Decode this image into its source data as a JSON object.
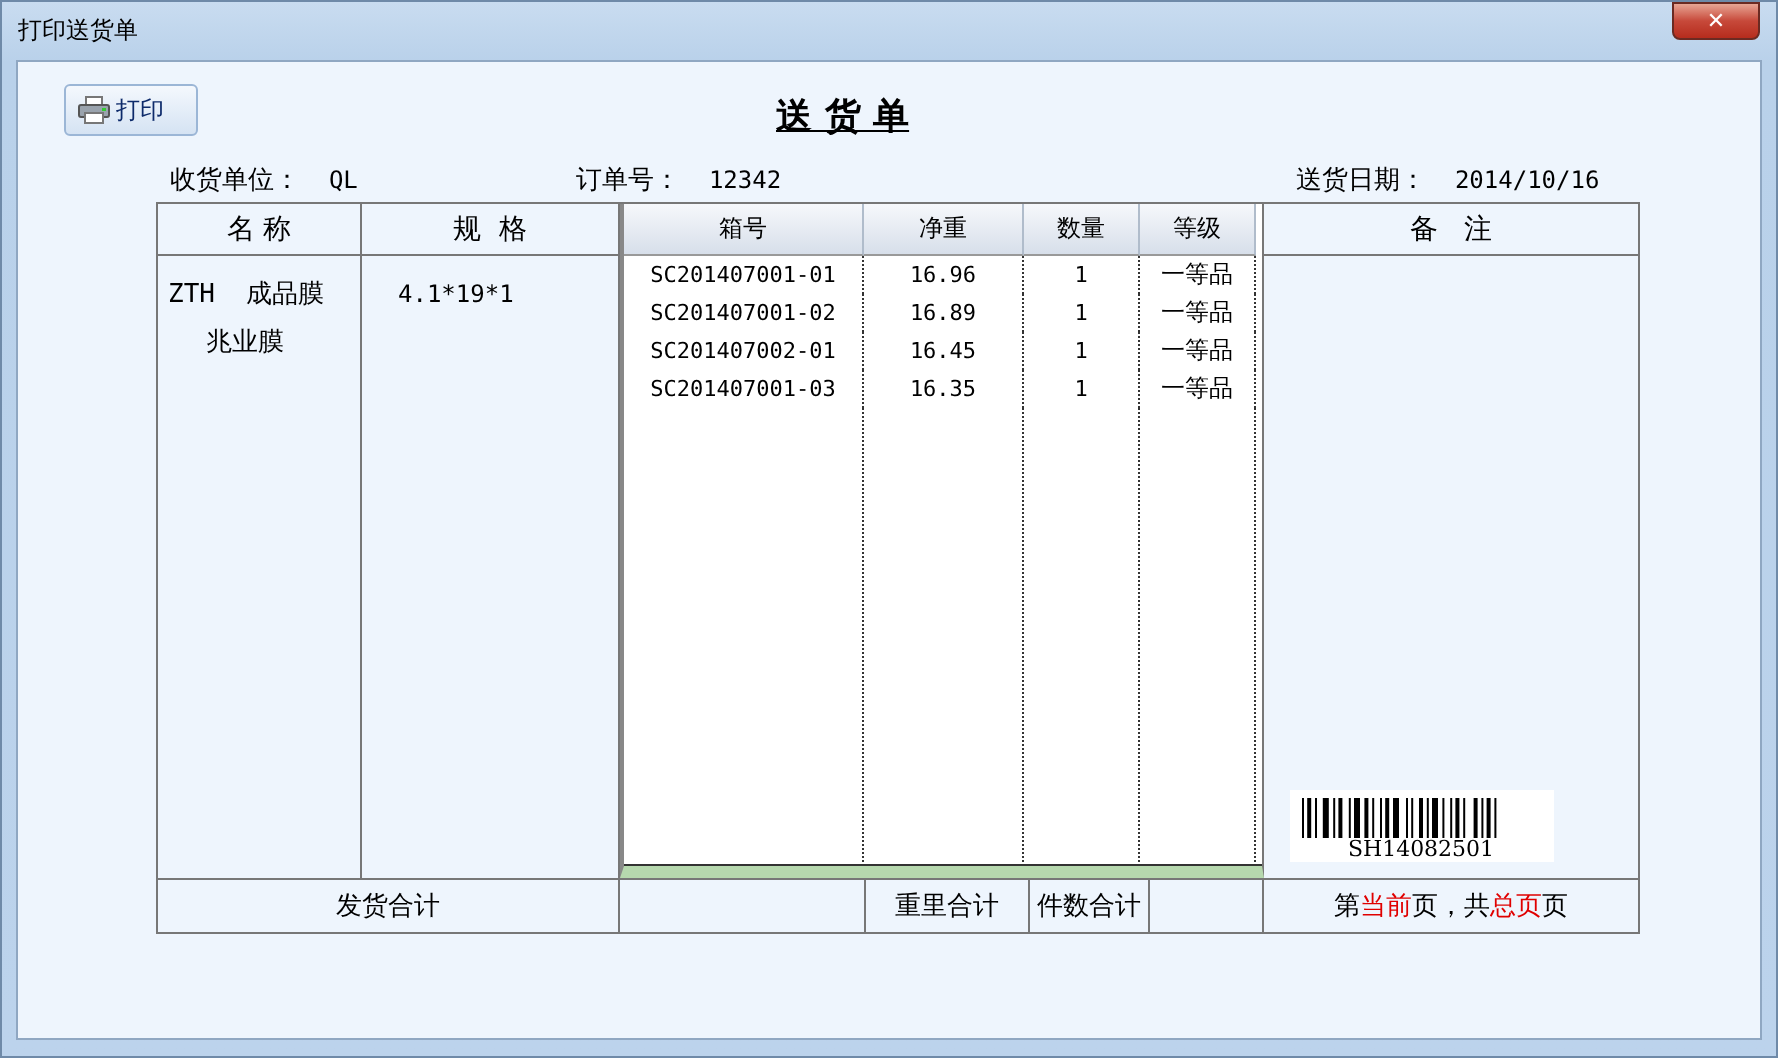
{
  "window": {
    "title": "打印送货单",
    "close": "✕"
  },
  "toolbar": {
    "print_button": "打印"
  },
  "document_title": "送 货 单",
  "info": [
    {
      "label": "收货单位：",
      "value": "QL"
    },
    {
      "label": "订单号：",
      "value": "12342"
    },
    {
      "label": "送货日期：",
      "value": "2014/10/16"
    }
  ],
  "table": {
    "columns": [
      "名 称",
      "规  格"
    ],
    "name_lines": [
      "ZTH  成品膜",
      "兆业膜"
    ],
    "spec": "4.1*19*1",
    "remarks_header": "备   注",
    "barcode": "SH14082501"
  },
  "grid": {
    "columns": [
      "箱号",
      "净重",
      "数量",
      "等级"
    ],
    "rows": [
      [
        "SC201407001-01",
        "16.96",
        "1",
        "一等品"
      ],
      [
        "SC201407001-02",
        "16.89",
        "1",
        "一等品"
      ],
      [
        "SC201407002-01",
        "16.45",
        "1",
        "一等品"
      ],
      [
        "SC201407001-03",
        "16.35",
        "1",
        "一等品"
      ]
    ]
  },
  "footer": {
    "shipment_total": "发货合计",
    "weight_total": "重里合计",
    "count_total": "件数合计",
    "page_parts": [
      {
        "text": "第",
        "highlight": false
      },
      {
        "text": "当前",
        "highlight": true
      },
      {
        "text": "页，共",
        "highlight": false
      },
      {
        "text": "总页",
        "highlight": true
      },
      {
        "text": "页",
        "highlight": false
      }
    ]
  }
}
